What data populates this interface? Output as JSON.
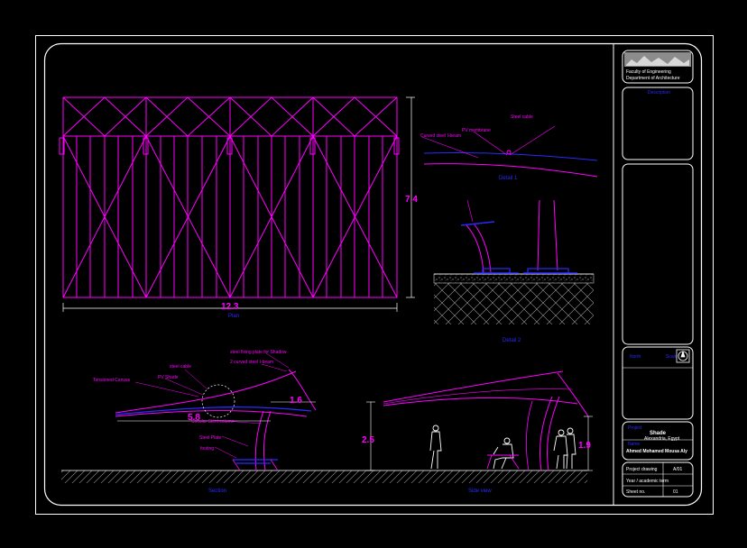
{
  "colors": {
    "magenta": "#ff00ff",
    "white": "#ffffff",
    "blue": "#2a2aff",
    "gray": "#8c8c8c",
    "background": "#000000"
  },
  "plan": {
    "dim_width": "12.3",
    "dim_height": "7.4",
    "caption": "Plan"
  },
  "detail1": {
    "label_a": "Steel cable",
    "label_b": "PV membrane",
    "label_c": "Curved steel I-beam",
    "caption": "Detail 1"
  },
  "detail2": {
    "caption": "Detail 2"
  },
  "section": {
    "caption": "Section",
    "dim_span": "5.8",
    "dim_overhang": "1.6",
    "label_membrane": "Tensioned Canvas",
    "label_cable": "steel cable",
    "label_pv": "PV Shade",
    "label_fix": "steel fixing plate for Shadow",
    "label_beam": "2 curved steel I-beam",
    "label_column": "Circular Steel column",
    "label_plate": "Steel Plate",
    "label_footing": "footing"
  },
  "side": {
    "caption": "Side view",
    "dim_height_left": "2.5",
    "dim_height_right": "1.9"
  },
  "title_block": {
    "univ_line1": "Faculty of Engineering",
    "univ_line2": "Department of Architecture",
    "notes_title": "Description",
    "north_label": "North",
    "scale_label": "Scale",
    "project_label": "Project",
    "project_name": "Shade",
    "project_location": "Alexandria, Egypt",
    "student_label": "Name",
    "student_name": "Ahmed Mohamed Mousa Aly",
    "row1_label": "Project drawing",
    "row1_value": "A/01",
    "row2_label": "Year / academic term",
    "row3_label": "Sheet no.",
    "row3_value": "01"
  }
}
